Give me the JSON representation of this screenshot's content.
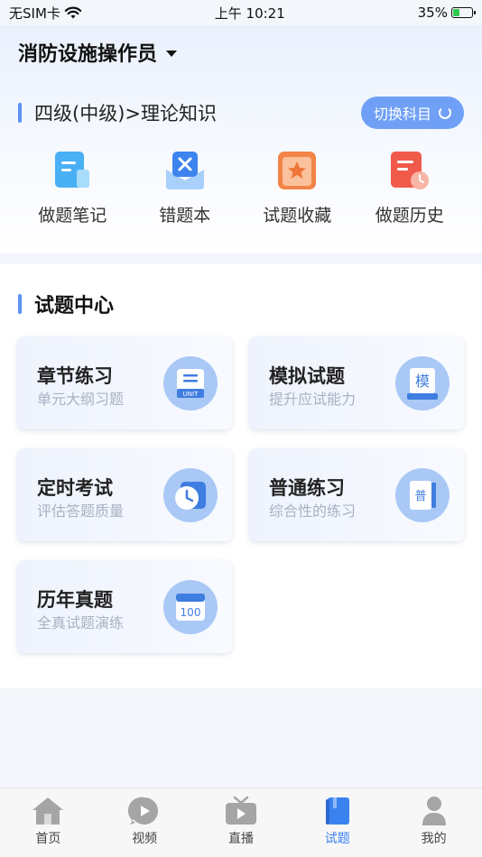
{
  "status_bar": {
    "carrier": "无SIM卡",
    "time": "上午 10:21",
    "battery": "35%",
    "battery_level": 0.35
  },
  "header": {
    "exam_name": "消防设施操作员"
  },
  "subject": {
    "title": "四级(中级)>理论知识",
    "switch_label": "切换科目"
  },
  "quick_actions": [
    {
      "label": "做题笔记",
      "icon": "note-icon"
    },
    {
      "label": "错题本",
      "icon": "wrong-book-icon"
    },
    {
      "label": "试题收藏",
      "icon": "favorite-icon"
    },
    {
      "label": "做题历史",
      "icon": "history-icon"
    }
  ],
  "section": {
    "title": "试题中心"
  },
  "cards": [
    {
      "title": "章节练习",
      "subtitle": "单元大纲习题",
      "icon_text": "UNIT"
    },
    {
      "title": "模拟试题",
      "subtitle": "提升应试能力",
      "icon_text": "模"
    },
    {
      "title": "定时考试",
      "subtitle": "评估答题质量",
      "icon_text": ""
    },
    {
      "title": "普通练习",
      "subtitle": "综合性的练习",
      "icon_text": "普"
    },
    {
      "title": "历年真题",
      "subtitle": "全真试题演练",
      "icon_text": "100"
    }
  ],
  "tabs": [
    {
      "label": "首页",
      "icon": "home-icon"
    },
    {
      "label": "视频",
      "icon": "video-icon"
    },
    {
      "label": "直播",
      "icon": "live-tv-icon"
    },
    {
      "label": "试题",
      "icon": "question-book-icon"
    },
    {
      "label": "我的",
      "icon": "profile-icon"
    }
  ],
  "colors": {
    "accent": "#3a82f0",
    "switch_button": "#6fa0f5",
    "card_icon_bg": "#a9c8f6"
  }
}
